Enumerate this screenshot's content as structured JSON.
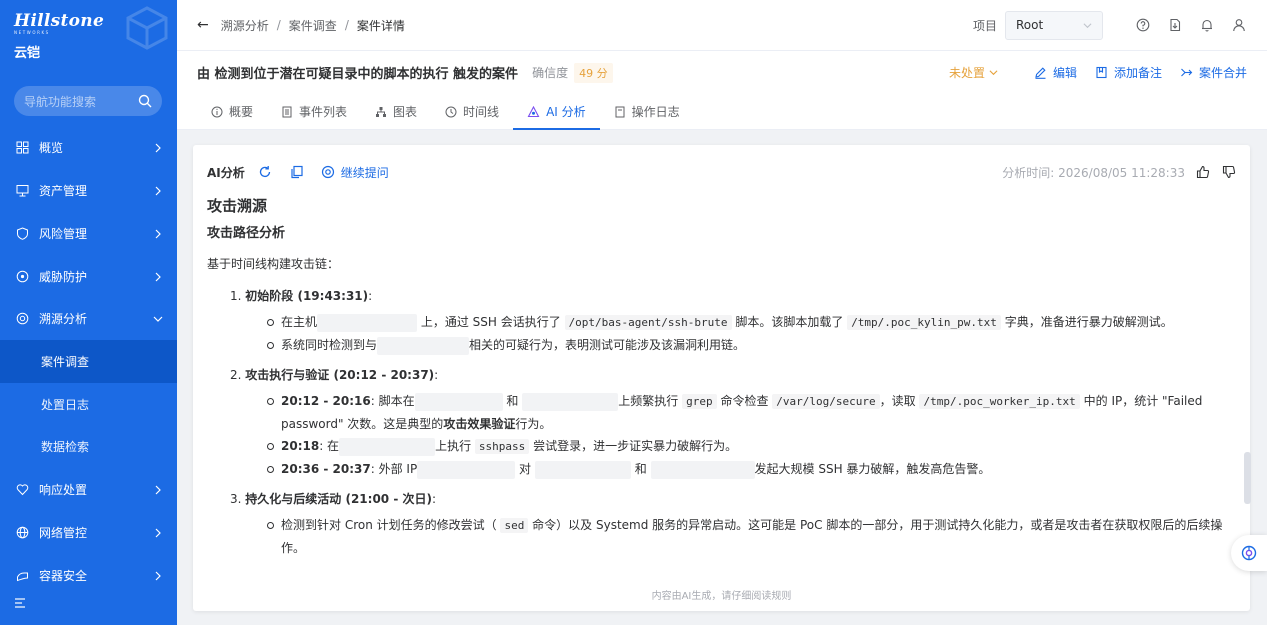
{
  "brand": {
    "name": "Hillstone",
    "sub": "NETWORKS",
    "product": "云铠"
  },
  "sidebar": {
    "search_placeholder": "导航功能搜索",
    "items": [
      {
        "label": "概览",
        "icon": "dashboard-icon"
      },
      {
        "label": "资产管理",
        "icon": "monitor-icon"
      },
      {
        "label": "风险管理",
        "icon": "shield-icon"
      },
      {
        "label": "威胁防护",
        "icon": "threat-icon"
      },
      {
        "label": "溯源分析",
        "icon": "trace-icon",
        "expanded": true
      },
      {
        "label": "响应处置",
        "icon": "response-icon"
      },
      {
        "label": "网络管控",
        "icon": "globe-icon"
      },
      {
        "label": "容器安全",
        "icon": "container-icon"
      }
    ],
    "subitems": [
      {
        "label": "案件调查",
        "active": true
      },
      {
        "label": "处置日志"
      },
      {
        "label": "数据检索"
      }
    ]
  },
  "header": {
    "breadcrumb": [
      "溯源分析",
      "案件调查",
      "案件详情"
    ],
    "project_label": "项目",
    "project_value": "Root"
  },
  "case": {
    "title": "由 检测到位于潜在可疑目录中的脚本的执行 触发的案件",
    "confidence_label": "确信度",
    "confidence_value": "49 分",
    "status": "未处置",
    "actions": {
      "edit": "编辑",
      "add_note": "添加备注",
      "merge": "案件合并"
    }
  },
  "tabs": [
    {
      "label": "概要",
      "icon": "info-icon"
    },
    {
      "label": "事件列表",
      "icon": "list-icon"
    },
    {
      "label": "图表",
      "icon": "graph-icon"
    },
    {
      "label": "时间线",
      "icon": "clock-icon"
    },
    {
      "label": "AI 分析",
      "icon": "ai-icon",
      "active": true
    },
    {
      "label": "操作日志",
      "icon": "log-icon"
    }
  ],
  "analysis": {
    "label": "AI分析",
    "continue_label": "继续提问",
    "time": "分析时间: 2026/08/05 11:28:33",
    "h2": "攻击溯源",
    "h3": "攻击路径分析",
    "intro": "基于时间线构建攻击链：",
    "step1": {
      "num": "1.",
      "title": "初始阶段 (19:43:31)",
      "colon": ":",
      "b1": {
        "a": "在主机",
        "b": "上，通过 SSH 会话执行了",
        "code1": "/opt/bas-agent/ssh-brute",
        "c": "脚本。该脚本加载了",
        "code2": "/tmp/.poc_kylin_pw.txt",
        "d": "字典，准备进行暴力破解测试。"
      },
      "b2": {
        "a": "系统同时检测到与",
        "b": "相关的可疑行为，表明测试可能涉及该漏洞利用链。"
      }
    },
    "step2": {
      "num": "2.",
      "title": "攻击执行与验证 (20:12 - 20:37)",
      "colon": ":",
      "b1": {
        "time": "20:12 - 20:16",
        "a": ": 脚本在",
        "b": "和",
        "c": "上频繁执行",
        "code1": "grep",
        "d": "命令检查",
        "code2": "/var/log/secure",
        "e": "，读取",
        "code3": "/tmp/.poc_worker_ip.txt",
        "f": "中的 IP，统计 \"Failed password\" 次数。这是典型的",
        "strong": "攻击效果验证",
        "g": "行为。"
      },
      "b2": {
        "time": "20:18",
        "a": ": 在",
        "b": "上执行",
        "code1": "sshpass",
        "c": "尝试登录，进一步证实暴力破解行为。"
      },
      "b3": {
        "time": "20:36 - 20:37",
        "a": ": 外部 IP",
        "b": "对",
        "c": "和",
        "d": "发起大规模 SSH 暴力破解，触发高危告警。"
      }
    },
    "step3": {
      "num": "3.",
      "title": "持久化与后续活动 (21:00 - 次日)",
      "colon": ":",
      "b1": {
        "a": "检测到针对 Cron 计划任务的修改尝试（",
        "code1": "sed",
        "b": "命令）以及 Systemd 服务的异常启动。这可能是 PoC 脚本的一部分，用于测试持久化能力，或者是攻击者在获取权限后的后续操",
        "c": "作。"
      }
    },
    "footer": "内容由AI生成，请仔细阅读规则"
  },
  "colors": {
    "sidebar": "#1c6be4",
    "sidebar_active": "#0d57c8",
    "accent": "#1c6be4",
    "warning": "#e6a23c"
  }
}
